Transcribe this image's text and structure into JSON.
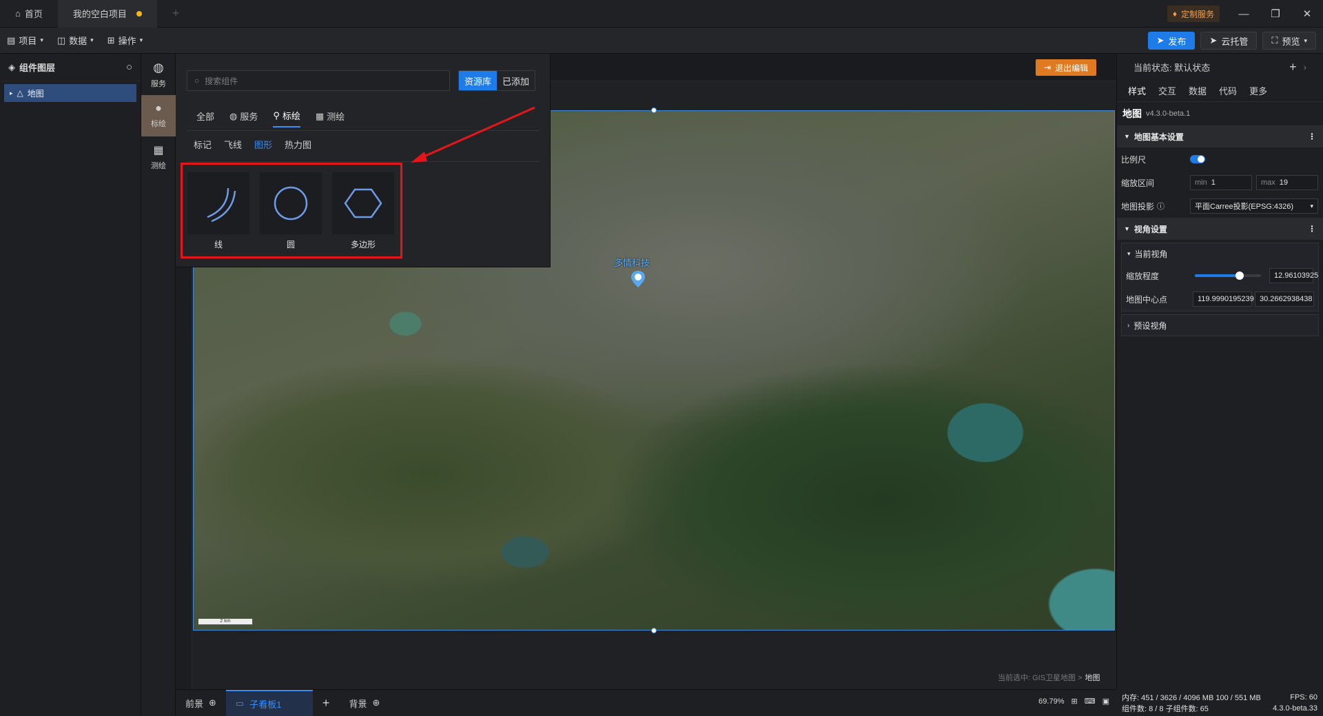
{
  "titlebar": {
    "tabs": [
      {
        "label": "首页"
      },
      {
        "label": "我的空白项目"
      }
    ],
    "custom_service": "定制服务"
  },
  "toolbar": {
    "menus": [
      {
        "label": "项目"
      },
      {
        "label": "数据"
      },
      {
        "label": "操作"
      }
    ],
    "publish": "发布",
    "cloud_host": "云托管",
    "preview": "预览"
  },
  "layers": {
    "title": "组件图层",
    "items": [
      {
        "label": "地图"
      }
    ]
  },
  "rail": [
    {
      "label": "服务"
    },
    {
      "label": "标绘"
    },
    {
      "label": "测绘"
    }
  ],
  "canvas": {
    "exit_edit": "退出编辑",
    "map_label": "多情科技",
    "scale_text": "2 km",
    "selected_path_prefix": "当前选中: GIS卫星地图 >",
    "selected_path_leaf": "地图"
  },
  "popover": {
    "search_placeholder": "搜索组件",
    "seg": [
      "资源库",
      "已添加"
    ],
    "categories": [
      {
        "label": "全部"
      },
      {
        "label": "服务"
      },
      {
        "label": "标绘"
      },
      {
        "label": "测绘"
      }
    ],
    "subtabs": [
      {
        "label": "标记"
      },
      {
        "label": "飞线"
      },
      {
        "label": "图形"
      },
      {
        "label": "热力图"
      }
    ],
    "cards": [
      {
        "label": "线"
      },
      {
        "label": "圆"
      },
      {
        "label": "多边形"
      }
    ]
  },
  "bottombar": {
    "tabs": [
      {
        "label": "前景"
      },
      {
        "label": "子看板1"
      },
      {
        "label": "背景"
      }
    ],
    "zoom": "69.79%"
  },
  "status": {
    "memory": "内存: 451 / 3626 / 4096 MB  100 / 551 MB",
    "fps": "FPS: 60",
    "components": "组件数: 8 / 8  子组件数: 65",
    "version": "4.3.0-beta.33"
  },
  "right": {
    "state": "当前状态:  默认状态",
    "tabs": [
      {
        "label": "样式"
      },
      {
        "label": "交互"
      },
      {
        "label": "数据"
      },
      {
        "label": "代码"
      },
      {
        "label": "更多"
      }
    ],
    "component_name": "地图",
    "component_version": "v4.3.0-beta.1",
    "basic_section": "地图基本设置",
    "scale_label": "比例尺",
    "zoom_range_label": "缩放区间",
    "min_prefix": "min",
    "min_value": "1",
    "max_prefix": "max",
    "max_value": "19",
    "projection_label": "地图投影",
    "projection_value": "平面Carree投影(EPSG:4326)",
    "view_section": "视角设置",
    "current_view": "当前视角",
    "zoom_label": "缩放程度",
    "zoom_value": "12.96103925",
    "zoom_fraction": 0.68,
    "center_label": "地图中心点",
    "center_lng": "119.9990195239",
    "center_lat": "30.2662938438",
    "preset_view": "预设视角"
  },
  "colors": {
    "accent": "#1d7bea",
    "highlight": "#e5161a",
    "exit": "#e07a20"
  }
}
